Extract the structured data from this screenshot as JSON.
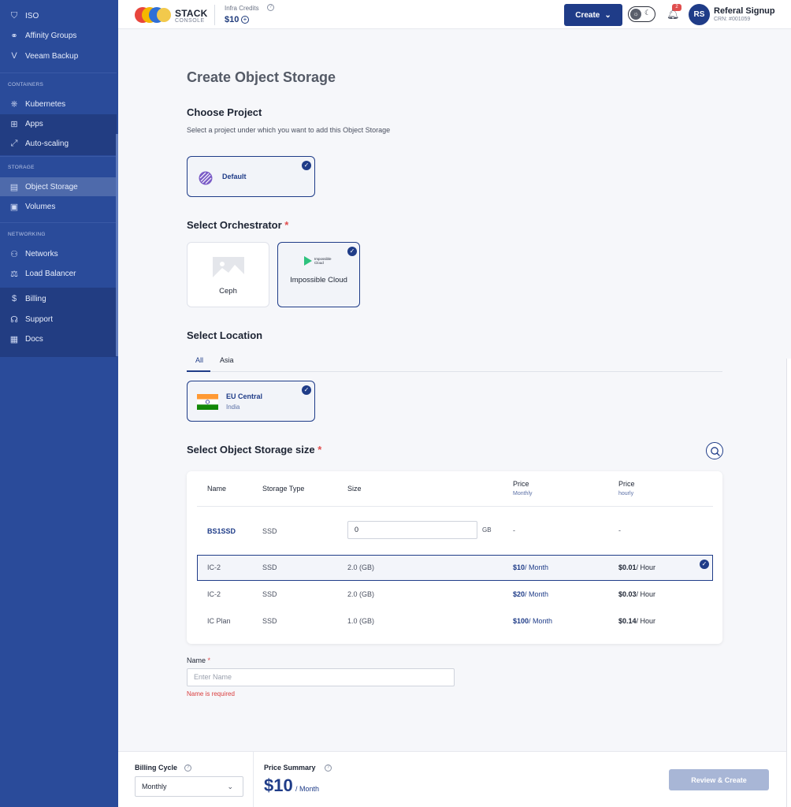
{
  "sidebar": {
    "items_top": [
      {
        "label": "ISO",
        "icon": "iso-icon"
      },
      {
        "label": "Affinity Groups",
        "icon": "affinity-icon"
      },
      {
        "label": "Veeam Backup",
        "icon": "veeam-icon"
      }
    ],
    "sections": {
      "containers": "CONTAINERS",
      "storage": "STORAGE",
      "networking": "NETWORKING"
    },
    "containers_items": [
      {
        "label": "Kubernetes"
      },
      {
        "label": "Apps"
      },
      {
        "label": "Auto-scaling"
      }
    ],
    "storage_items": [
      {
        "label": "Object Storage"
      },
      {
        "label": "Volumes"
      }
    ],
    "networking_items": [
      {
        "label": "Networks"
      },
      {
        "label": "Load Balancer"
      }
    ],
    "bottom_items": [
      {
        "label": "Billing"
      },
      {
        "label": "Support"
      },
      {
        "label": "Docs"
      }
    ]
  },
  "header": {
    "logo_text": "STACK",
    "logo_sub": "CONSOLE",
    "credits_label": "Infra Credits",
    "credits_value": "$10",
    "create_label": "Create",
    "notification_count": "2",
    "avatar_initials": "RS",
    "user_name": "Referal Signup",
    "user_crn": "CRN: #001059"
  },
  "main": {
    "title": "Create Object Storage",
    "project_section": {
      "title": "Choose Project",
      "description": "Select a project under which you want to add this Object Storage",
      "selected_project": "Default"
    },
    "orchestrator_section": {
      "title": "Select Orchestrator",
      "options": [
        {
          "label": "Ceph",
          "selected": false
        },
        {
          "label": "Impossible Cloud",
          "selected": true,
          "logo_text": "Impossible Cloud"
        }
      ]
    },
    "location_section": {
      "title": "Select Location",
      "tabs": [
        "All",
        "Asia"
      ],
      "active_tab": "All",
      "location": {
        "name": "EU Central",
        "country": "India"
      }
    },
    "size_section": {
      "title": "Select Object Storage size",
      "columns": {
        "name": "Name",
        "storage_type": "Storage Type",
        "size": "Size",
        "price_monthly": "Price",
        "price_monthly_sub": "Monthly",
        "price_hourly": "Price",
        "price_hourly_sub": "hourly"
      },
      "custom_row": {
        "name": "BS1SSD",
        "type": "SSD",
        "size_value": "0",
        "size_unit": "GB",
        "monthly": "-",
        "hourly": "-"
      },
      "rows": [
        {
          "name": "IC-2",
          "type": "SSD",
          "size": "2.0 (GB)",
          "monthly": "$10",
          "monthly_unit": "/ Month",
          "hourly": "$0.01",
          "hourly_unit": "/ Hour",
          "selected": true
        },
        {
          "name": "IC-2",
          "type": "SSD",
          "size": "2.0 (GB)",
          "monthly": "$20",
          "monthly_unit": "/ Month",
          "hourly": "$0.03",
          "hourly_unit": "/ Hour",
          "selected": false
        },
        {
          "name": "IC Plan",
          "type": "SSD",
          "size": "1.0 (GB)",
          "monthly": "$100",
          "monthly_unit": "/ Month",
          "hourly": "$0.14",
          "hourly_unit": "/ Hour",
          "selected": false
        }
      ]
    },
    "name_field": {
      "label": "Name",
      "placeholder": "Enter Name",
      "error": "Name is required"
    }
  },
  "footer": {
    "billing_cycle_label": "Billing Cycle",
    "billing_cycle_value": "Monthly",
    "price_summary_label": "Price Summary",
    "price_value": "$10",
    "price_unit": "/ Month",
    "review_label": "Review & Create"
  },
  "colors": {
    "sidebar": "#2a4b9a",
    "accent": "#1f3c88",
    "error": "#d93d3d",
    "disabled_button": "#a8b6d6"
  }
}
